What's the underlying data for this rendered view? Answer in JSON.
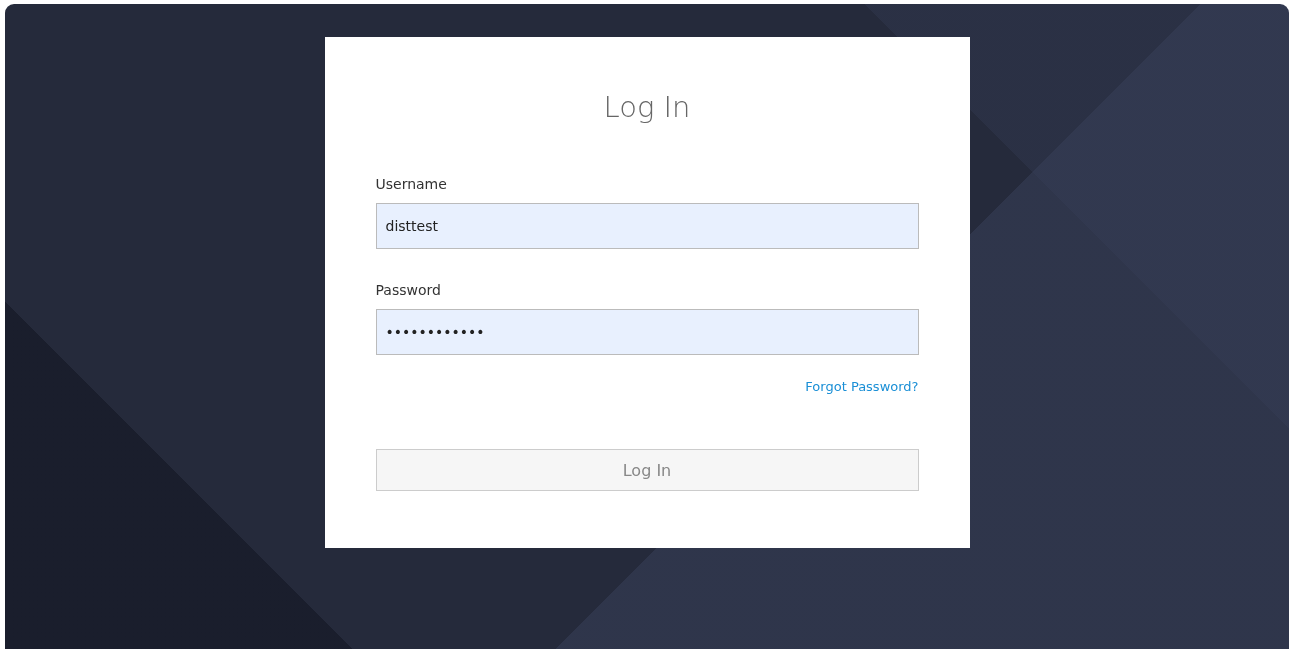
{
  "form": {
    "title": "Log In",
    "fields": [
      {
        "label": "Username",
        "value": "disttest"
      },
      {
        "label": "Password",
        "value": "••••••••••••"
      }
    ],
    "forgot_link": "Forgot Password?",
    "submit": {
      "label": "Log In",
      "disabled": true
    }
  }
}
